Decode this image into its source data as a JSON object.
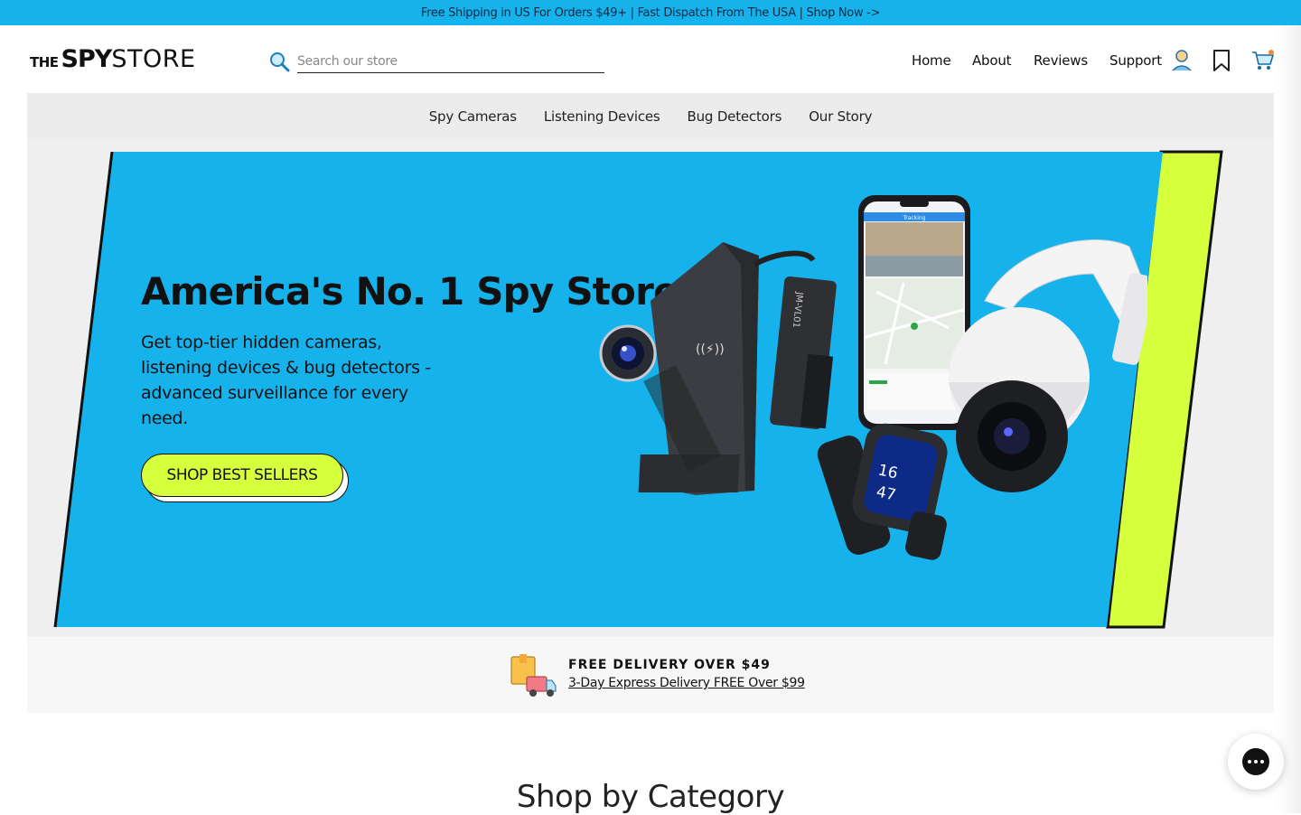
{
  "announcement": {
    "text": "Free Shipping in US For Orders $49+ | Fast Dispatch From The USA | Shop Now ->"
  },
  "logo": {
    "the": "THE",
    "spy": "SPY",
    "store": "STORE"
  },
  "search": {
    "placeholder": "Search our store",
    "icon": "search-icon"
  },
  "header_nav": {
    "links": [
      "Home",
      "About",
      "Reviews",
      "Support"
    ],
    "icons": [
      "account-icon",
      "bookmark-icon",
      "cart-icon"
    ]
  },
  "category_nav": [
    "Spy Cameras",
    "Listening Devices",
    "Bug Detectors",
    "Our Story"
  ],
  "hero": {
    "title": "America's No. 1 Spy Store",
    "subtitle": "Get top-tier hidden cameras, listening devices & bug detectors - advanced surveillance for every need.",
    "button": "SHOP BEST SELLERS",
    "colors": {
      "panel": "#16b2ec",
      "accent": "#d6ff3c"
    },
    "phone_label": "Tracking",
    "watch_time": [
      "16",
      "47"
    ]
  },
  "delivery": {
    "title": "FREE DELIVERY OVER $49",
    "link": "3-Day Express Delivery FREE Over $99"
  },
  "shop_by_category": {
    "title": "Shop by Category"
  },
  "chat": {
    "icon": "chat-icon"
  }
}
